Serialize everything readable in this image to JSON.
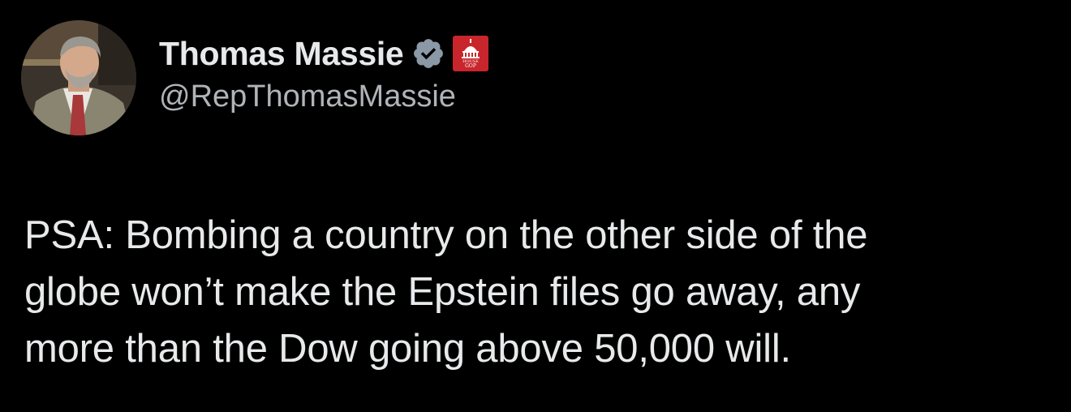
{
  "author": {
    "display_name": "Thomas Massie",
    "handle": "@RepThomasMassie",
    "verified": true,
    "verified_icon": "verified-badge-icon",
    "affiliation_badge": {
      "icon": "house-gop-capitol-icon",
      "text_top": "HOUSE",
      "text_bottom": "GOP",
      "color": "#c8262c"
    }
  },
  "post": {
    "text": "PSA: Bombing a country on the other side of the\nglobe won’t make the Epstein files go away, any\nmore than the Dow going above 50,000 will."
  },
  "colors": {
    "background": "#000000",
    "primary_text": "#e7e9ea",
    "secondary_text": "#b0b4b8",
    "verified": "#8b98a5"
  }
}
